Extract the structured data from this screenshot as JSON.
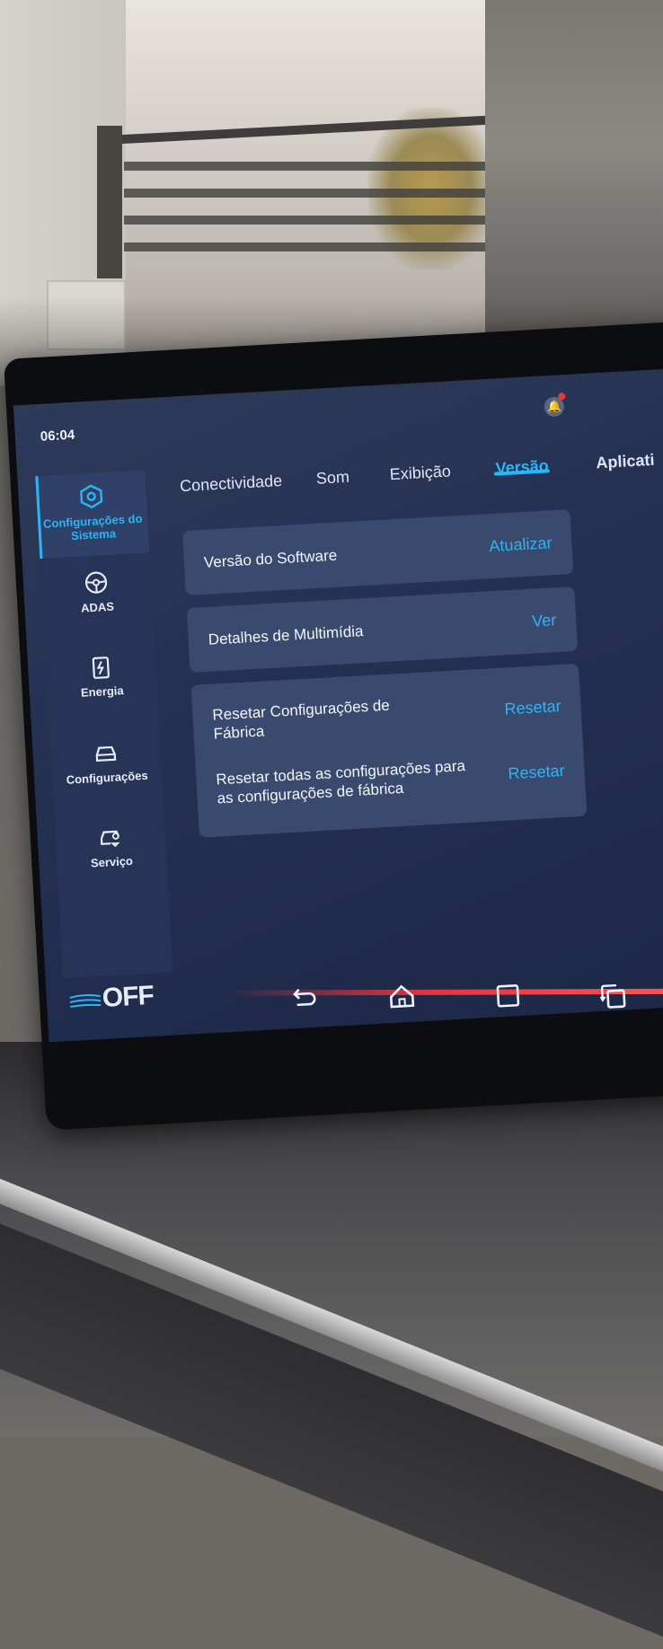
{
  "status": {
    "time": "06:04"
  },
  "sidebar": {
    "items": [
      {
        "label": "Configurações do Sistema",
        "icon": "settings-hex-icon",
        "active": true
      },
      {
        "label": "ADAS",
        "icon": "steering-wheel-icon",
        "active": false
      },
      {
        "label": "Energia",
        "icon": "battery-charge-icon",
        "active": false
      },
      {
        "label": "Configurações",
        "icon": "car-icon",
        "active": false
      },
      {
        "label": "Serviço",
        "icon": "car-service-icon",
        "active": false
      }
    ]
  },
  "tabs": [
    {
      "label": "Conectividade",
      "active": false
    },
    {
      "label": "Som",
      "active": false
    },
    {
      "label": "Exibição",
      "active": false
    },
    {
      "label": "Versão",
      "active": true
    },
    {
      "label": "Aplicati",
      "active": false
    }
  ],
  "cards": {
    "software": {
      "label": "Versão do Software",
      "action": "Atualizar"
    },
    "multimedia": {
      "label": "Detalhes de Multimídia",
      "action": "Ver"
    },
    "reset": [
      {
        "label": "Resetar Configurações de Fábrica",
        "action": "Resetar"
      },
      {
        "label": "Resetar todas as configurações para as configurações de fábrica",
        "action": "Resetar"
      }
    ]
  },
  "navbar": {
    "climate_label": "OFF",
    "buttons": [
      "back-icon",
      "home-icon",
      "recents-icon",
      "split-screen-icon"
    ]
  },
  "colors": {
    "accent": "#29b6f6",
    "screen_bg": "#243052",
    "card_bg": "#3a4a6e",
    "sidebar_bg": "#263457"
  }
}
